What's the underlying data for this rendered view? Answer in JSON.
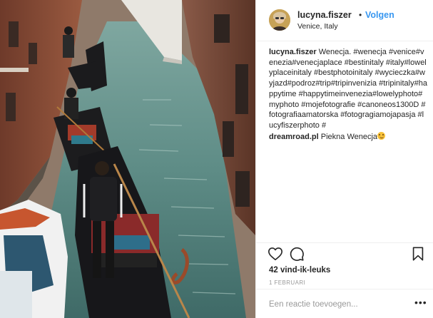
{
  "photo": {
    "alt_label": "Gondolas in a narrow Venice canal"
  },
  "header": {
    "username": "lucyna.fiszer",
    "separator": "•",
    "follow_label": "Volgen",
    "location": "Venice, Italy"
  },
  "caption": {
    "username": "lucyna.fiszer",
    "text": "Wenecja. #wenecja #venice#venezia#venecjaplace #bestinitaly #italy#lowelyplaceinitaly #bestphotoinitaly #wycieczka#wyjazd#podroz#trip#tripinvenizia #tripinitaly#happytime #happytimeinvenezia#lowelyphoto#myphoto #mojefotografie #canoneos1300D #fotografiaamatorska #fotogragiamojapasja #lucyfiszerphoto #"
  },
  "comment": {
    "username": "dreamroad.pl",
    "text": "Piekna Wenecja"
  },
  "actions": {
    "like_icon": "heart-icon",
    "comment_icon": "comment-icon",
    "save_icon": "bookmark-icon"
  },
  "likes": "42 vind-ik-leuks",
  "date": "1 FEBRUARI",
  "add_comment_placeholder": "Een reactie toevoegen...",
  "more_label": "•••",
  "colors": {
    "link": "#3897f0",
    "text": "#262626",
    "muted": "#999999",
    "border": "#efefef"
  }
}
